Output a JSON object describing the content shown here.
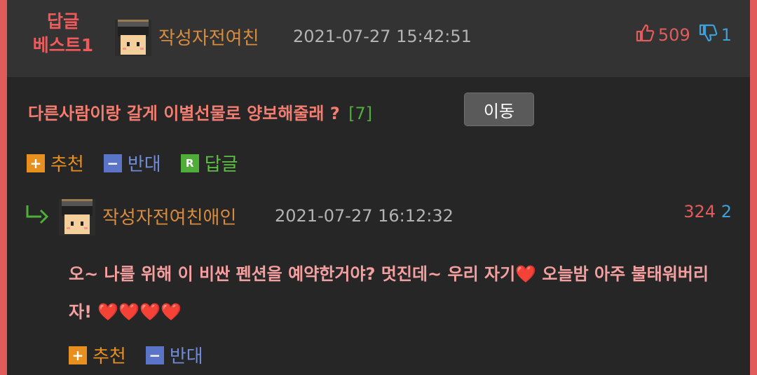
{
  "best_badge": {
    "line1": "답글",
    "line2": "베스트1"
  },
  "post": {
    "author": "작성자전여친",
    "datetime": "2021-07-27 15:42:51",
    "upvotes": "509",
    "downvotes": "1",
    "title": "다른사람이랑 갈게 이별선물로 양보해줄래 ?",
    "reply_count": "[7]",
    "move_button": "이동"
  },
  "post_actions": {
    "recommend": "추천",
    "oppose": "반대",
    "reply": "답글"
  },
  "reply": {
    "author": "작성자전여친애인",
    "datetime": "2021-07-27 16:12:32",
    "upvotes": "324",
    "downvotes": "2",
    "text_part1": "오~ 나를 위해 이 비싼 펜션을 예약한거야? 멋진데~ 우리 자기",
    "heart1": "❤️",
    "text_part2": " 오늘밤 아주 불태워버리자! ",
    "heart2": "❤️❤️❤️❤️"
  },
  "reply_actions": {
    "recommend": "추천",
    "oppose": "반대"
  },
  "colors": {
    "background": "#262626",
    "header": "#333333",
    "border": "#e15b5b",
    "author": "#d98b3d",
    "accent_up": "#e25c5c",
    "accent_down": "#3ea0d8"
  },
  "icons": [
    "thumbs-up-icon",
    "thumbs-down-icon",
    "reply-arrow-icon",
    "plus-icon",
    "minus-icon",
    "r-icon"
  ]
}
